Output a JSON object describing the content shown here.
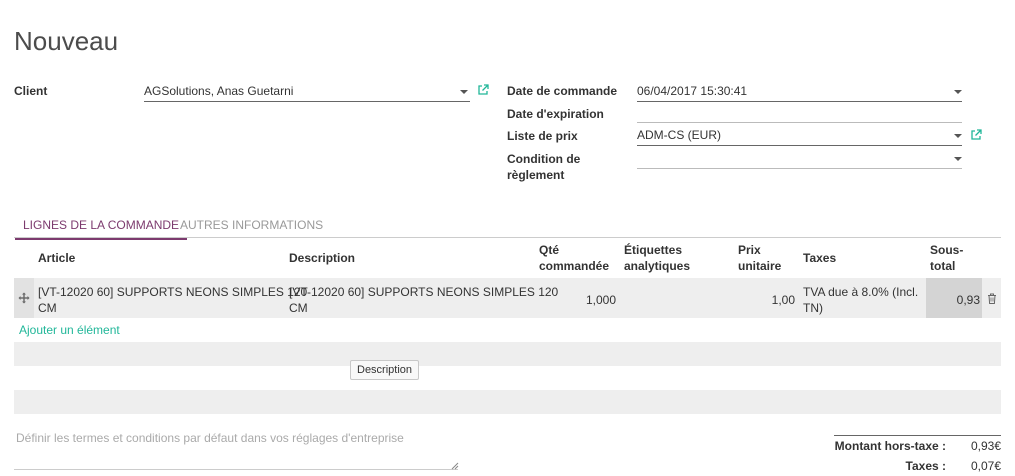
{
  "page": {
    "title": "Nouveau"
  },
  "form": {
    "client": {
      "label": "Client",
      "value": "AGSolutions, Anas Guetarni"
    },
    "date_commande": {
      "label": "Date de commande",
      "value": "06/04/2017 15:30:41"
    },
    "date_expiration": {
      "label": "Date d'expiration",
      "value": ""
    },
    "liste_prix": {
      "label": "Liste de prix",
      "value": "ADM-CS (EUR)"
    },
    "condition_reglement": {
      "label_line1": "Condition de",
      "label_line2": "règlement",
      "value": ""
    }
  },
  "tabs": [
    {
      "label": "Lignes de la commande",
      "active": true
    },
    {
      "label": "Autres informations",
      "active": false
    }
  ],
  "table": {
    "headers": {
      "article": "Article",
      "description": "Description",
      "qty_line1": "Qté",
      "qty_line2": "commandée",
      "tags_line1": "Étiquettes",
      "tags_line2": "analytiques",
      "price_line1": "Prix",
      "price_line2": "unitaire",
      "taxes": "Taxes",
      "subtotal_line1": "Sous-",
      "subtotal_line2": "total"
    },
    "rows": [
      {
        "article_line1": "[VT-12020 60] SUPPORTS NEONS SIMPLES 120",
        "article_line2": "CM",
        "description_line1": "[VT-12020 60] SUPPORTS NEONS SIMPLES 120",
        "description_line2": "CM",
        "qty": "1,000",
        "tags": "",
        "price": "1,00",
        "taxes_line1": "TVA due à 8.0% (Incl.",
        "taxes_line2": "TN)",
        "subtotal": "0,93"
      }
    ],
    "add_item": "Ajouter un élément",
    "section_button": "Description"
  },
  "terms_placeholder": "Définir les termes et conditions par défaut dans vos réglages d'entreprise",
  "totals": {
    "untaxed_label": "Montant hors-taxe :",
    "untaxed_value": "0,93€",
    "taxes_label": "Taxes :",
    "taxes_value": "0,07€"
  },
  "colors": {
    "accent": "#7c3a6e",
    "link": "#21b799",
    "row_bg": "#eeeeee"
  },
  "icons": {
    "external": "external-link-icon",
    "drag": "drag-handle-icon",
    "delete": "trash-icon",
    "dropdown": "chevron-down-icon"
  }
}
